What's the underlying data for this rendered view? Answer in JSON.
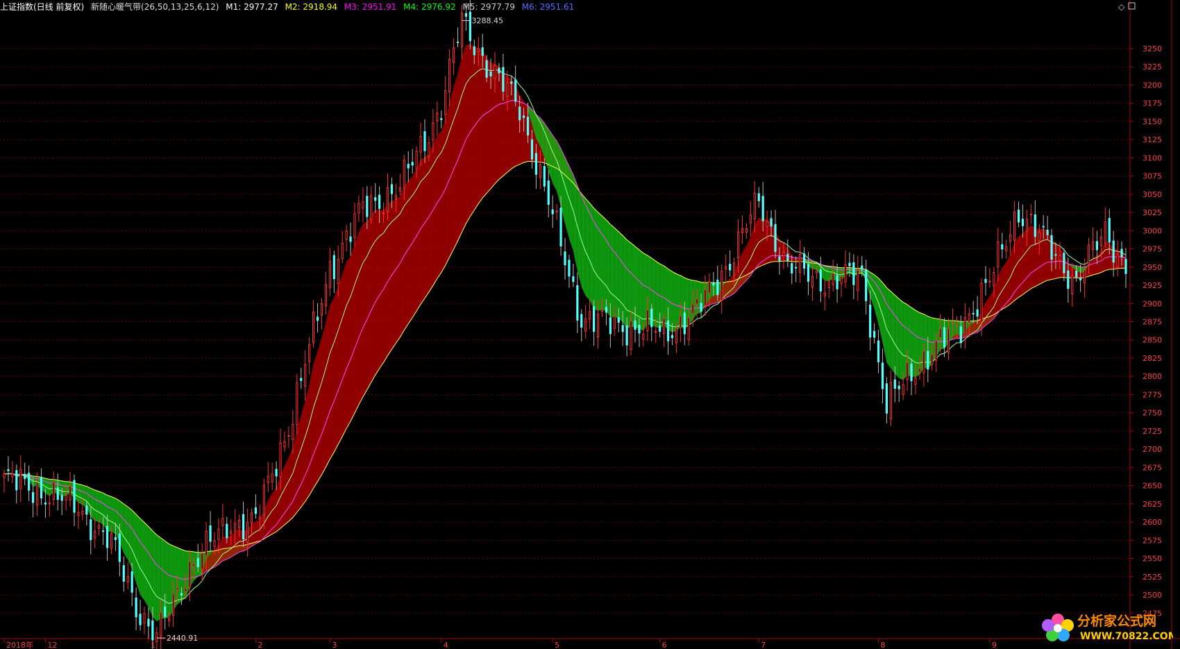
{
  "header": {
    "instrument": "上证指数(日线 前复权)",
    "indicator": "新随心暖气带(26,50,13,25,6,12)",
    "values": [
      {
        "label": "M1: 2977.27",
        "color": "#ffffff"
      },
      {
        "label": "M2: 2918.94",
        "color": "#ffff00"
      },
      {
        "label": "M3: 2951.91",
        "color": "#ff00ff"
      },
      {
        "label": "M4: 2976.92",
        "color": "#00ff00"
      },
      {
        "label": "M5: 2977.79",
        "color": "#cccccc"
      },
      {
        "label": "M6: 2951.61",
        "color": "#4f6fff"
      }
    ]
  },
  "watermark": {
    "cn": "分析家公式网",
    "url": "WWW.70822.COM"
  },
  "colors": {
    "background": "#000000",
    "grid": "#5a0000",
    "axis": "#b00000",
    "up_candle": "#ff3030",
    "down_candle": "#54ffff",
    "up_band": "#c00000",
    "down_band": "#10b010",
    "price_text": "#ff4040"
  },
  "chart_data": {
    "type": "candlestick",
    "ylim": [
      2440,
      3290
    ],
    "y_ticks": [
      2475,
      2500,
      2525,
      2550,
      2575,
      2600,
      2625,
      2650,
      2675,
      2700,
      2725,
      2750,
      2775,
      2800,
      2825,
      2850,
      2875,
      2900,
      2925,
      2950,
      2975,
      3000,
      3025,
      3050,
      3075,
      3100,
      3125,
      3150,
      3175,
      3200,
      3225,
      3250
    ],
    "x_ticks": [
      {
        "label": "2018年",
        "idx": 0
      },
      {
        "label": "12",
        "idx": 10
      },
      {
        "label": "1",
        "idx": 35
      },
      {
        "label": "2",
        "idx": 61
      },
      {
        "label": "3",
        "idx": 79
      },
      {
        "label": "4",
        "idx": 106
      },
      {
        "label": "5",
        "idx": 133
      },
      {
        "label": "6",
        "idx": 159
      },
      {
        "label": "7",
        "idx": 183
      },
      {
        "label": "8",
        "idx": 212
      },
      {
        "label": "9",
        "idx": 239
      }
    ],
    "annotations": [
      {
        "label": "3288.45",
        "idx": 111,
        "value": 3288.45
      },
      {
        "label": "2440.91",
        "idx": 37,
        "value": 2440.91
      }
    ],
    "key_closes": [
      [
        0,
        2660
      ],
      [
        10,
        2640
      ],
      [
        18,
        2620
      ],
      [
        26,
        2570
      ],
      [
        33,
        2475
      ],
      [
        37,
        2441
      ],
      [
        45,
        2540
      ],
      [
        55,
        2600
      ],
      [
        61,
        2600
      ],
      [
        70,
        2750
      ],
      [
        79,
        2950
      ],
      [
        87,
        3030
      ],
      [
        96,
        3060
      ],
      [
        106,
        3170
      ],
      [
        111,
        3288
      ],
      [
        118,
        3220
      ],
      [
        125,
        3170
      ],
      [
        133,
        3020
      ],
      [
        140,
        2880
      ],
      [
        150,
        2870
      ],
      [
        160,
        2860
      ],
      [
        168,
        2890
      ],
      [
        176,
        2960
      ],
      [
        183,
        3040
      ],
      [
        190,
        2950
      ],
      [
        200,
        2930
      ],
      [
        208,
        2940
      ],
      [
        214,
        2760
      ],
      [
        222,
        2820
      ],
      [
        232,
        2870
      ],
      [
        239,
        2930
      ],
      [
        246,
        3030
      ],
      [
        253,
        2980
      ],
      [
        260,
        2930
      ],
      [
        267,
        3000
      ],
      [
        272,
        2950
      ]
    ]
  }
}
